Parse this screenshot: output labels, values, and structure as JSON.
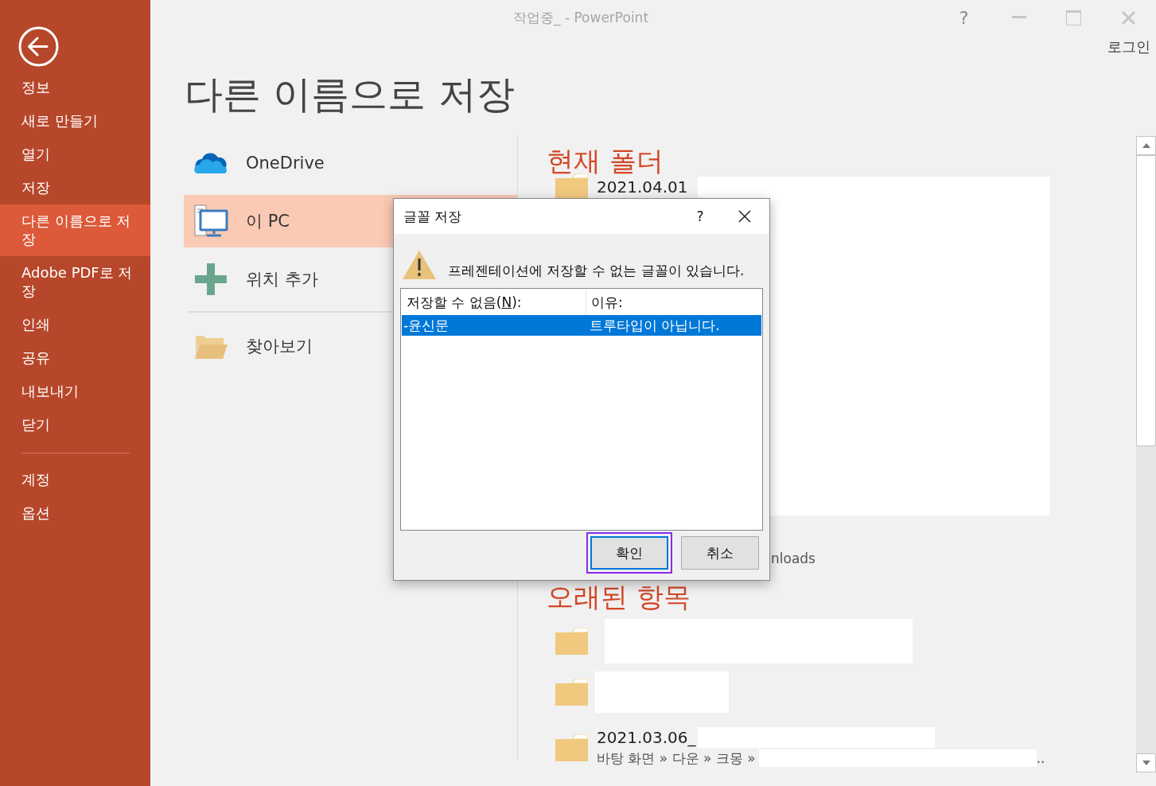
{
  "window": {
    "title": "작업중_ - PowerPoint",
    "help": "?",
    "sign_in": "로그인"
  },
  "sidebar": {
    "items": [
      {
        "label": "정보",
        "selected": false
      },
      {
        "label": "새로 만들기",
        "selected": false
      },
      {
        "label": "열기",
        "selected": false
      },
      {
        "label": "저장",
        "selected": false
      },
      {
        "label": "다른 이름으로 저장",
        "selected": true
      },
      {
        "label": "Adobe PDF로 저장",
        "selected": false
      },
      {
        "label": "인쇄",
        "selected": false
      },
      {
        "label": "공유",
        "selected": false
      },
      {
        "label": "내보내기",
        "selected": false
      },
      {
        "label": "닫기",
        "selected": false
      }
    ],
    "footer_items": [
      {
        "label": "계정",
        "selected": false
      },
      {
        "label": "옵션",
        "selected": false
      }
    ]
  },
  "page_title": "다른 이름으로 저장",
  "locations": [
    {
      "label": "OneDrive",
      "kind": "cloud",
      "selected": false
    },
    {
      "label": "이 PC",
      "kind": "computer",
      "selected": true
    },
    {
      "label": "위치 추가",
      "kind": "add",
      "selected": false
    },
    {
      "label": "찾아보기",
      "kind": "browse",
      "selected": false
    }
  ],
  "current_folder": {
    "heading": "현재 폴더",
    "items": [
      {
        "title": "2021.04.01",
        "redacted": true
      },
      {
        "path": "nloads",
        "redacted": false
      }
    ]
  },
  "older_items": {
    "heading": "오래된 항목",
    "items": [
      {
        "redacted": true
      },
      {
        "redacted": true
      },
      {
        "title": "2021.03.06_",
        "path": "바탕 화면 » 다운 » 크몽 »",
        "path_end": "..",
        "redacted": true
      }
    ]
  },
  "dialog": {
    "title": "글꼴 저장",
    "help": "?",
    "message": "프레젠테이션에 저장할 수 없는 글꼴이 있습니다.",
    "columns": [
      {
        "before": "저장할 수 없음(",
        "key": "N",
        "after": "):"
      },
      {
        "before": "이유:"
      }
    ],
    "rows": [
      {
        "cells": [
          "-윤신문",
          "트루타입이 아닙니다."
        ],
        "selected": true
      }
    ],
    "buttons": [
      {
        "label": "확인",
        "focused": true
      },
      {
        "label": "취소",
        "focused": false
      }
    ]
  }
}
